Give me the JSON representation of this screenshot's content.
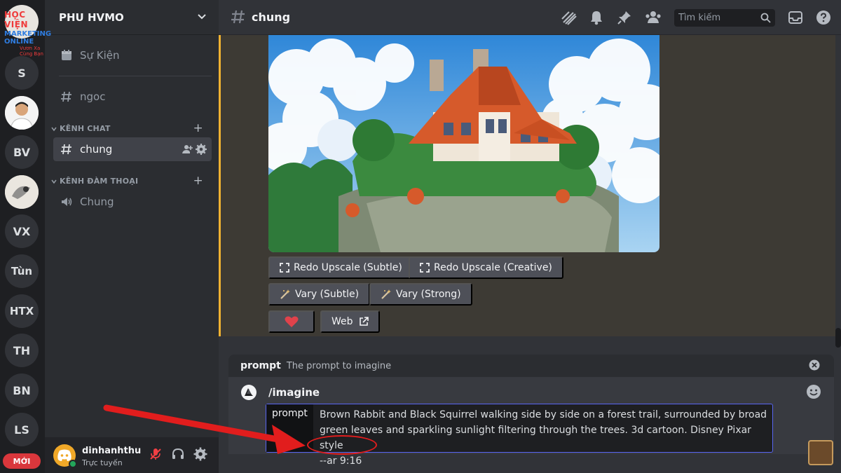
{
  "logo": {
    "line1": "HỌC VIỆN",
    "line2": "MARKETING ONLINE",
    "line3": "Vươn Xa Cùng Bạn"
  },
  "servers": [
    {
      "label": "S"
    },
    {
      "label": ""
    },
    {
      "label": "BV"
    },
    {
      "label": ""
    },
    {
      "label": "VX"
    },
    {
      "label": "Tùn"
    },
    {
      "label": "HTX"
    },
    {
      "label": "TH"
    },
    {
      "label": "BN"
    },
    {
      "label": "LS"
    }
  ],
  "new_badge": "MỚI",
  "sidebar": {
    "server_name": "PHU HVMO",
    "events": "Sự Kiện",
    "channel_ngoc": "ngoc",
    "cat_chat": "KÊNH CHAT",
    "active_channel": "chung",
    "cat_voice": "KÊNH ĐÀM THOẠI",
    "voice_channel": "Chung"
  },
  "user": {
    "name": "dinhanhthu",
    "status": "Trực tuyến"
  },
  "topbar": {
    "channel": "chung",
    "search_placeholder": "Tìm kiếm"
  },
  "buttons": {
    "redo_subtle": "Redo Upscale (Subtle)",
    "redo_creative": "Redo Upscale (Creative)",
    "vary_subtle": "Vary (Subtle)",
    "vary_strong": "Vary (Strong)",
    "web": "Web"
  },
  "composer": {
    "option_name": "prompt",
    "option_desc": "The prompt to imagine",
    "command": "/imagine",
    "param_label": "prompt",
    "param_value_line1": "Brown Rabbit and Black Squirrel walking side by side on a forest trail, surrounded by broad",
    "param_value_line2": "green leaves and sparkling sunlight filtering through the trees. 3d cartoon. Disney Pixar style",
    "param_value_line3": "--ar 9:16"
  },
  "colors": {
    "accent": "#5865f2",
    "embed_border": "#f0b232",
    "online": "#23a55a",
    "annotation": "#e11d1d"
  }
}
